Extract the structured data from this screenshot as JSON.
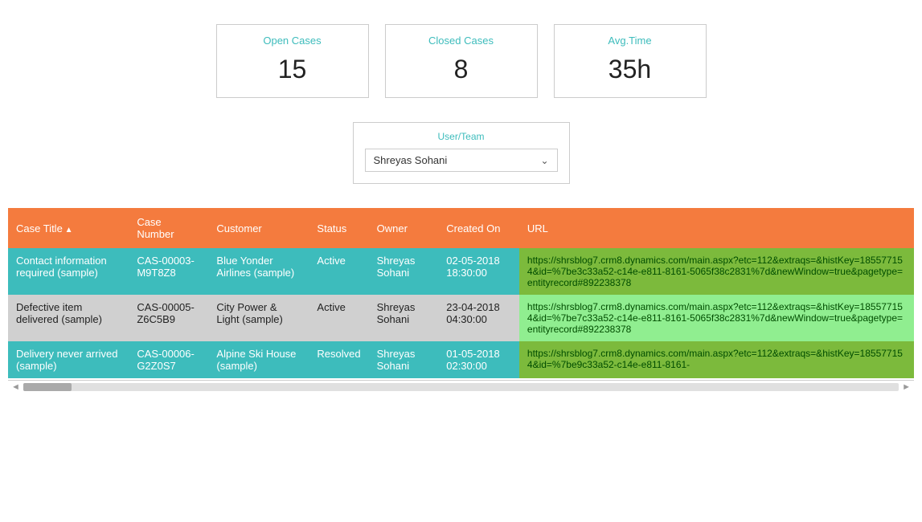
{
  "stats": {
    "open_cases": {
      "label": "Open Cases",
      "value": "15"
    },
    "closed_cases": {
      "label": "Closed Cases",
      "value": "8"
    },
    "avg_time": {
      "label": "Avg.Time",
      "value": "35h"
    }
  },
  "filter": {
    "label": "User/Team",
    "selected": "Shreyas Sohani"
  },
  "table": {
    "columns": [
      "Case Title",
      "Case Number",
      "Customer",
      "Status",
      "Owner",
      "Created On",
      "URL"
    ],
    "rows": [
      {
        "case_title": "Contact information required (sample)",
        "case_number": "CAS-00003-M9T8Z8",
        "customer": "Blue Yonder Airlines (sample)",
        "status": "Active",
        "owner": "Shreyas Sohani",
        "created_on": "02-05-2018 18:30:00",
        "url": "https://shrsblog7.crm8.dynamics.com/main.aspx?etc=112&extraqs=&histKey=185577154&id=%7be3c33a52-c14e-e811-8161-5065f38c2831%7d&newWindow=true&pagetype=entityrecord#892238378"
      },
      {
        "case_title": "Defective item delivered (sample)",
        "case_number": "CAS-00005-Z6C5B9",
        "customer": "City Power & Light (sample)",
        "status": "Active",
        "owner": "Shreyas Sohani",
        "created_on": "23-04-2018 04:30:00",
        "url": "https://shrsblog7.crm8.dynamics.com/main.aspx?etc=112&extraqs=&histKey=185577154&id=%7be7c33a52-c14e-e811-8161-5065f38c2831%7d&newWindow=true&pagetype=entityrecord#892238378"
      },
      {
        "case_title": "Delivery never arrived (sample)",
        "case_number": "CAS-00006-G2Z0S7",
        "customer": "Alpine Ski House (sample)",
        "status": "Resolved",
        "owner": "Shreyas Sohani",
        "created_on": "01-05-2018 02:30:00",
        "url": "https://shrsblog7.crm8.dynamics.com/main.aspx?etc=112&extraqs=&histKey=185577154&id=%7be9c33a52-c14e-e811-8161-"
      }
    ]
  }
}
